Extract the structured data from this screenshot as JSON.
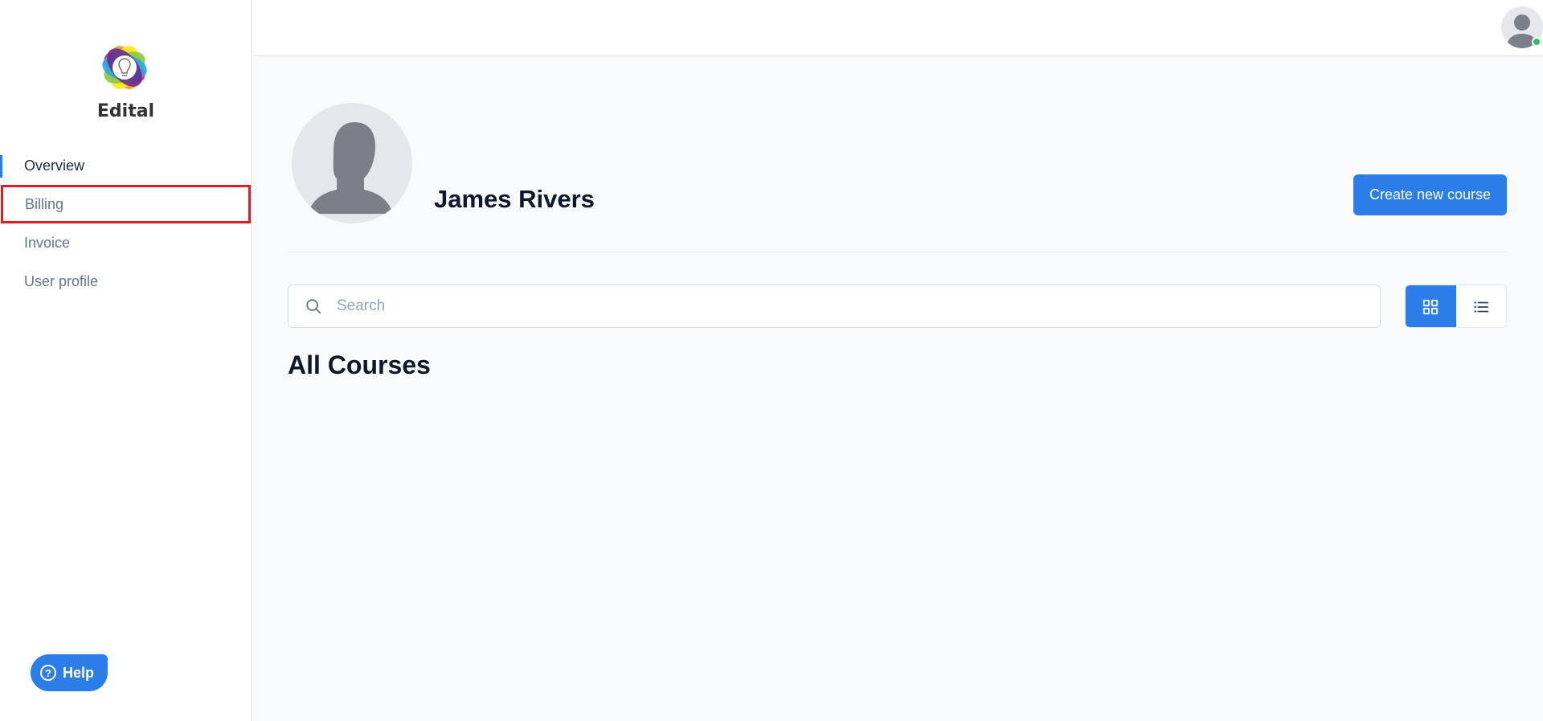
{
  "app": {
    "brand_name": "Edital"
  },
  "sidebar": {
    "items": [
      {
        "label": "Overview",
        "active": true
      },
      {
        "label": "Billing",
        "active": false,
        "highlighted": true
      },
      {
        "label": "Invoice",
        "active": false
      },
      {
        "label": "User profile",
        "active": false
      }
    ],
    "help_label": "Help"
  },
  "header": {
    "user_online": true
  },
  "profile": {
    "name": "James Rivers",
    "create_button_label": "Create new course"
  },
  "search": {
    "placeholder": "Search",
    "value": ""
  },
  "view_toggle": {
    "selected": "grid",
    "options": [
      "grid",
      "list"
    ]
  },
  "courses": {
    "title": "All Courses",
    "items": []
  },
  "colors": {
    "accent": "#2b7de9",
    "highlight_outline": "#e31b23",
    "online": "#22c55e"
  },
  "icons": {
    "logo": "lightbulb-flower-logo",
    "help": "question-circle-icon",
    "search": "search-icon",
    "grid": "grid-icon",
    "list": "list-icon",
    "avatar": "user-silhouette-icon"
  }
}
